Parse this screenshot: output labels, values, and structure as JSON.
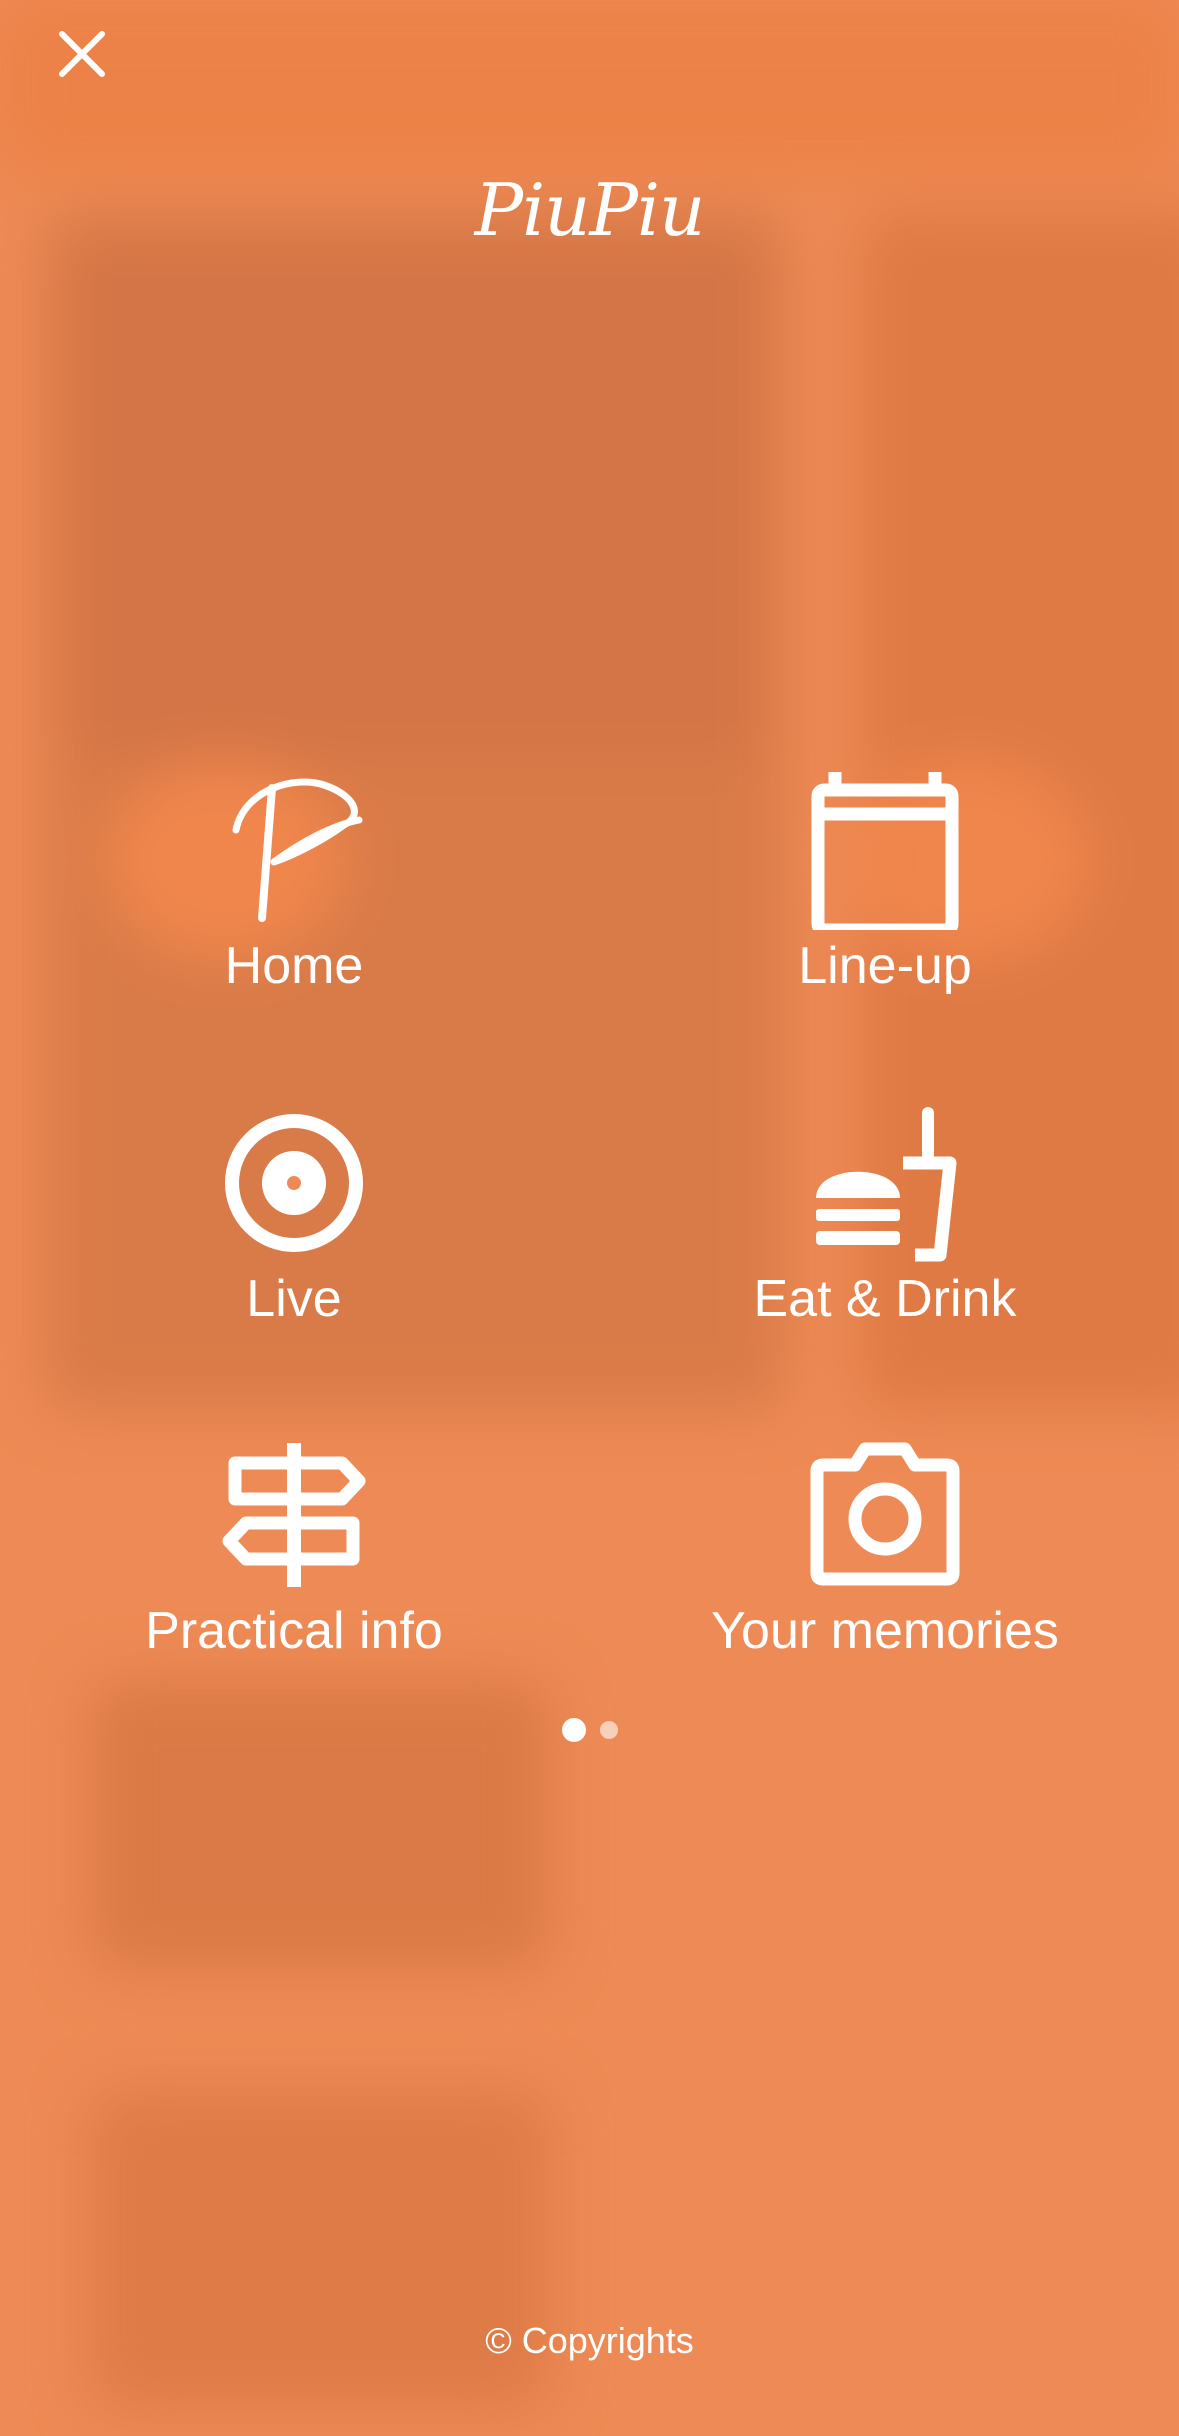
{
  "app": {
    "logo_text": "PiuPiu"
  },
  "colors": {
    "background": "#ee8a55",
    "foreground": "#ffffff"
  },
  "menu": {
    "items": [
      {
        "label": "Home",
        "icon": "piupiu-p-icon"
      },
      {
        "label": "Line-up",
        "icon": "calendar-icon"
      },
      {
        "label": "Live",
        "icon": "live-target-icon"
      },
      {
        "label": "Eat & Drink",
        "icon": "burger-drink-icon"
      },
      {
        "label": "Practical info",
        "icon": "signpost-icon"
      },
      {
        "label": "Your memories",
        "icon": "camera-icon"
      }
    ]
  },
  "pager": {
    "pages": 2,
    "current": 1
  },
  "footer": {
    "text": "© Copyrights"
  },
  "icons": {
    "close": "close-icon"
  }
}
